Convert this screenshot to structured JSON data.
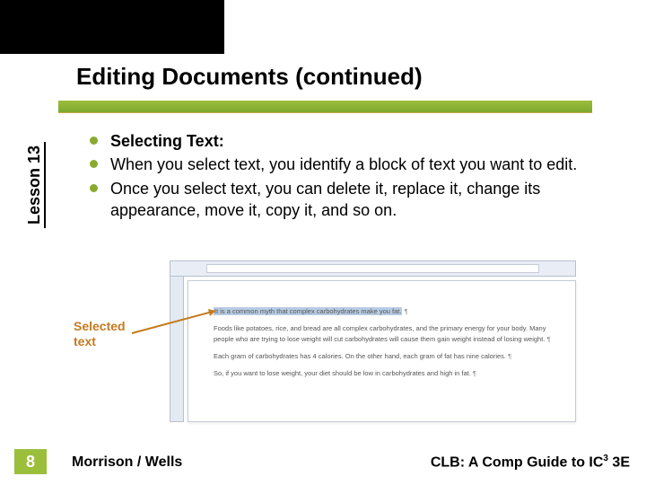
{
  "title": "Editing Documents (continued)",
  "sidebar_label": "Lesson 13",
  "bullets": {
    "b1": "Selecting Text:",
    "b2": "When you select text, you identify a block of text you want to edit.",
    "b3": "Once you select text, you can delete it, replace it, change its appearance, move it, copy it, and so on."
  },
  "callout": {
    "line1": "Selected",
    "line2": "text"
  },
  "doc": {
    "highlighted": "It is a common myth that complex carbohydrates make you fat.",
    "p2": "Foods like potatoes, rice, and bread are all complex carbohydrates, and the primary energy for your body. Many people who are trying to lose weight will cut carbohydrates will cause them gain weight instead of losing weight.",
    "p3": "Each gram of carbohydrates has 4 calories. On the other hand, each gram of fat has nine calories.",
    "p4": "So, if you want to lose weight, your diet should be low in carbohydrates and high in fat."
  },
  "footer": {
    "page_number": "8",
    "left": "Morrison / Wells",
    "right_prefix": "CLB: A Comp Guide to IC",
    "right_sup": "3",
    "right_suffix": " 3E"
  }
}
